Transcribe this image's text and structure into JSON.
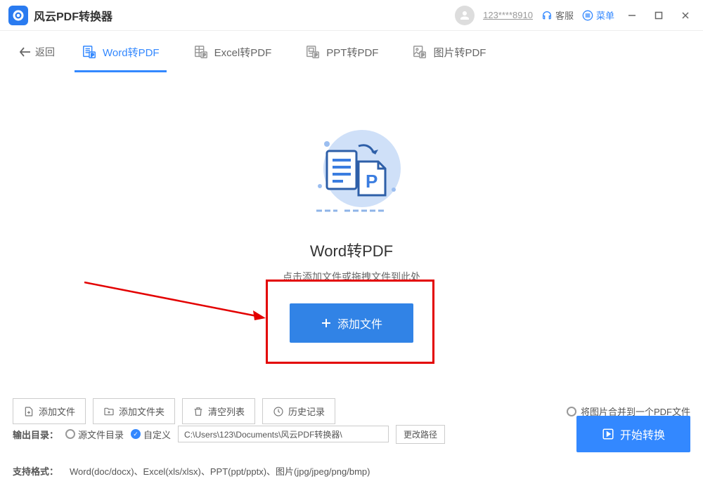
{
  "app": {
    "title": "风云PDF转换器"
  },
  "header": {
    "user_id": "123****8910",
    "support": "客服",
    "menu": "菜单"
  },
  "nav": {
    "back": "返回",
    "tabs": [
      {
        "label": "Word转PDF"
      },
      {
        "label": "Excel转PDF"
      },
      {
        "label": "PPT转PDF"
      },
      {
        "label": "图片转PDF"
      }
    ]
  },
  "main": {
    "title": "Word转PDF",
    "subtitle": "点击添加文件或拖拽文件到此处",
    "add_button": "添加文件"
  },
  "toolbar": {
    "add_file": "添加文件",
    "add_folder": "添加文件夹",
    "clear_list": "清空列表",
    "history": "历史记录",
    "merge_option": "将图片合并到一个PDF文件"
  },
  "output": {
    "label": "输出目录：",
    "source_dir": "源文件目录",
    "custom": "自定义",
    "path": "C:\\Users\\123\\Documents\\风云PDF转换器\\",
    "change_path": "更改路径",
    "start": "开始转换"
  },
  "formats": {
    "label": "支持格式：",
    "value": "Word(doc/docx)、Excel(xls/xlsx)、PPT(ppt/pptx)、图片(jpg/jpeg/png/bmp)"
  }
}
